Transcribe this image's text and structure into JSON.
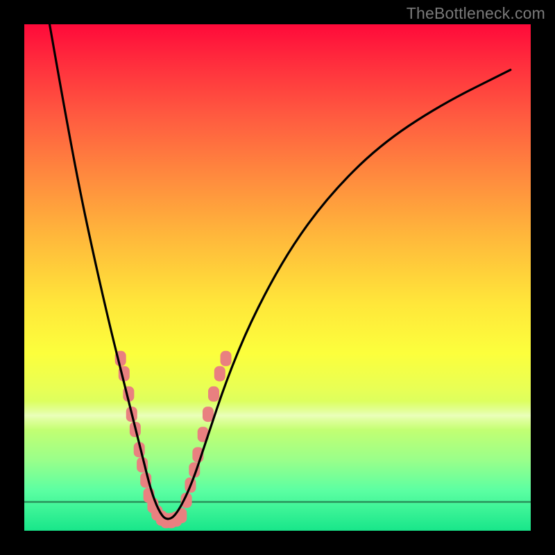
{
  "watermark": "TheBottleneck.com",
  "chart_data": {
    "type": "line",
    "title": "",
    "xlabel": "",
    "ylabel": "",
    "xlim": [
      0,
      100
    ],
    "ylim": [
      0,
      100
    ],
    "grid": false,
    "background_gradient": {
      "top_color": "#ff0a3a",
      "mid_color": "#ffe63a",
      "bottom_color": "#18e68a"
    },
    "series": [
      {
        "name": "bottleneck-curve",
        "color": "#000000",
        "x": [
          5,
          8,
          11,
          14,
          17,
          19.5,
          21.5,
          23.5,
          25,
          26.5,
          28,
          30,
          33,
          36,
          40,
          45,
          52,
          60,
          70,
          82,
          96
        ],
        "values": [
          100,
          83,
          67,
          53,
          40,
          30,
          22,
          14,
          8,
          4,
          2,
          3,
          9,
          18,
          30,
          42,
          55,
          66,
          76,
          84,
          91
        ]
      }
    ],
    "scatter_clusters": [
      {
        "name": "left-cluster",
        "color": "#e98080",
        "points": [
          {
            "x": 19.0,
            "y": 34
          },
          {
            "x": 19.7,
            "y": 31
          },
          {
            "x": 20.6,
            "y": 27
          },
          {
            "x": 21.2,
            "y": 23
          },
          {
            "x": 21.9,
            "y": 20
          },
          {
            "x": 22.7,
            "y": 16
          },
          {
            "x": 23.3,
            "y": 13
          },
          {
            "x": 24.0,
            "y": 10
          },
          {
            "x": 24.6,
            "y": 7
          },
          {
            "x": 25.4,
            "y": 5
          },
          {
            "x": 26.2,
            "y": 3.5
          },
          {
            "x": 27.1,
            "y": 2.5
          }
        ]
      },
      {
        "name": "valley-cluster",
        "color": "#e98080",
        "points": [
          {
            "x": 28.0,
            "y": 2
          },
          {
            "x": 29.0,
            "y": 2
          },
          {
            "x": 30.0,
            "y": 2.3
          },
          {
            "x": 31.0,
            "y": 3
          }
        ]
      },
      {
        "name": "right-cluster",
        "color": "#e98080",
        "points": [
          {
            "x": 32.0,
            "y": 6
          },
          {
            "x": 32.8,
            "y": 9
          },
          {
            "x": 33.6,
            "y": 12
          },
          {
            "x": 34.3,
            "y": 15
          },
          {
            "x": 35.3,
            "y": 19
          },
          {
            "x": 36.3,
            "y": 23
          },
          {
            "x": 37.4,
            "y": 27
          },
          {
            "x": 38.6,
            "y": 31
          },
          {
            "x": 39.8,
            "y": 34
          }
        ]
      }
    ]
  }
}
